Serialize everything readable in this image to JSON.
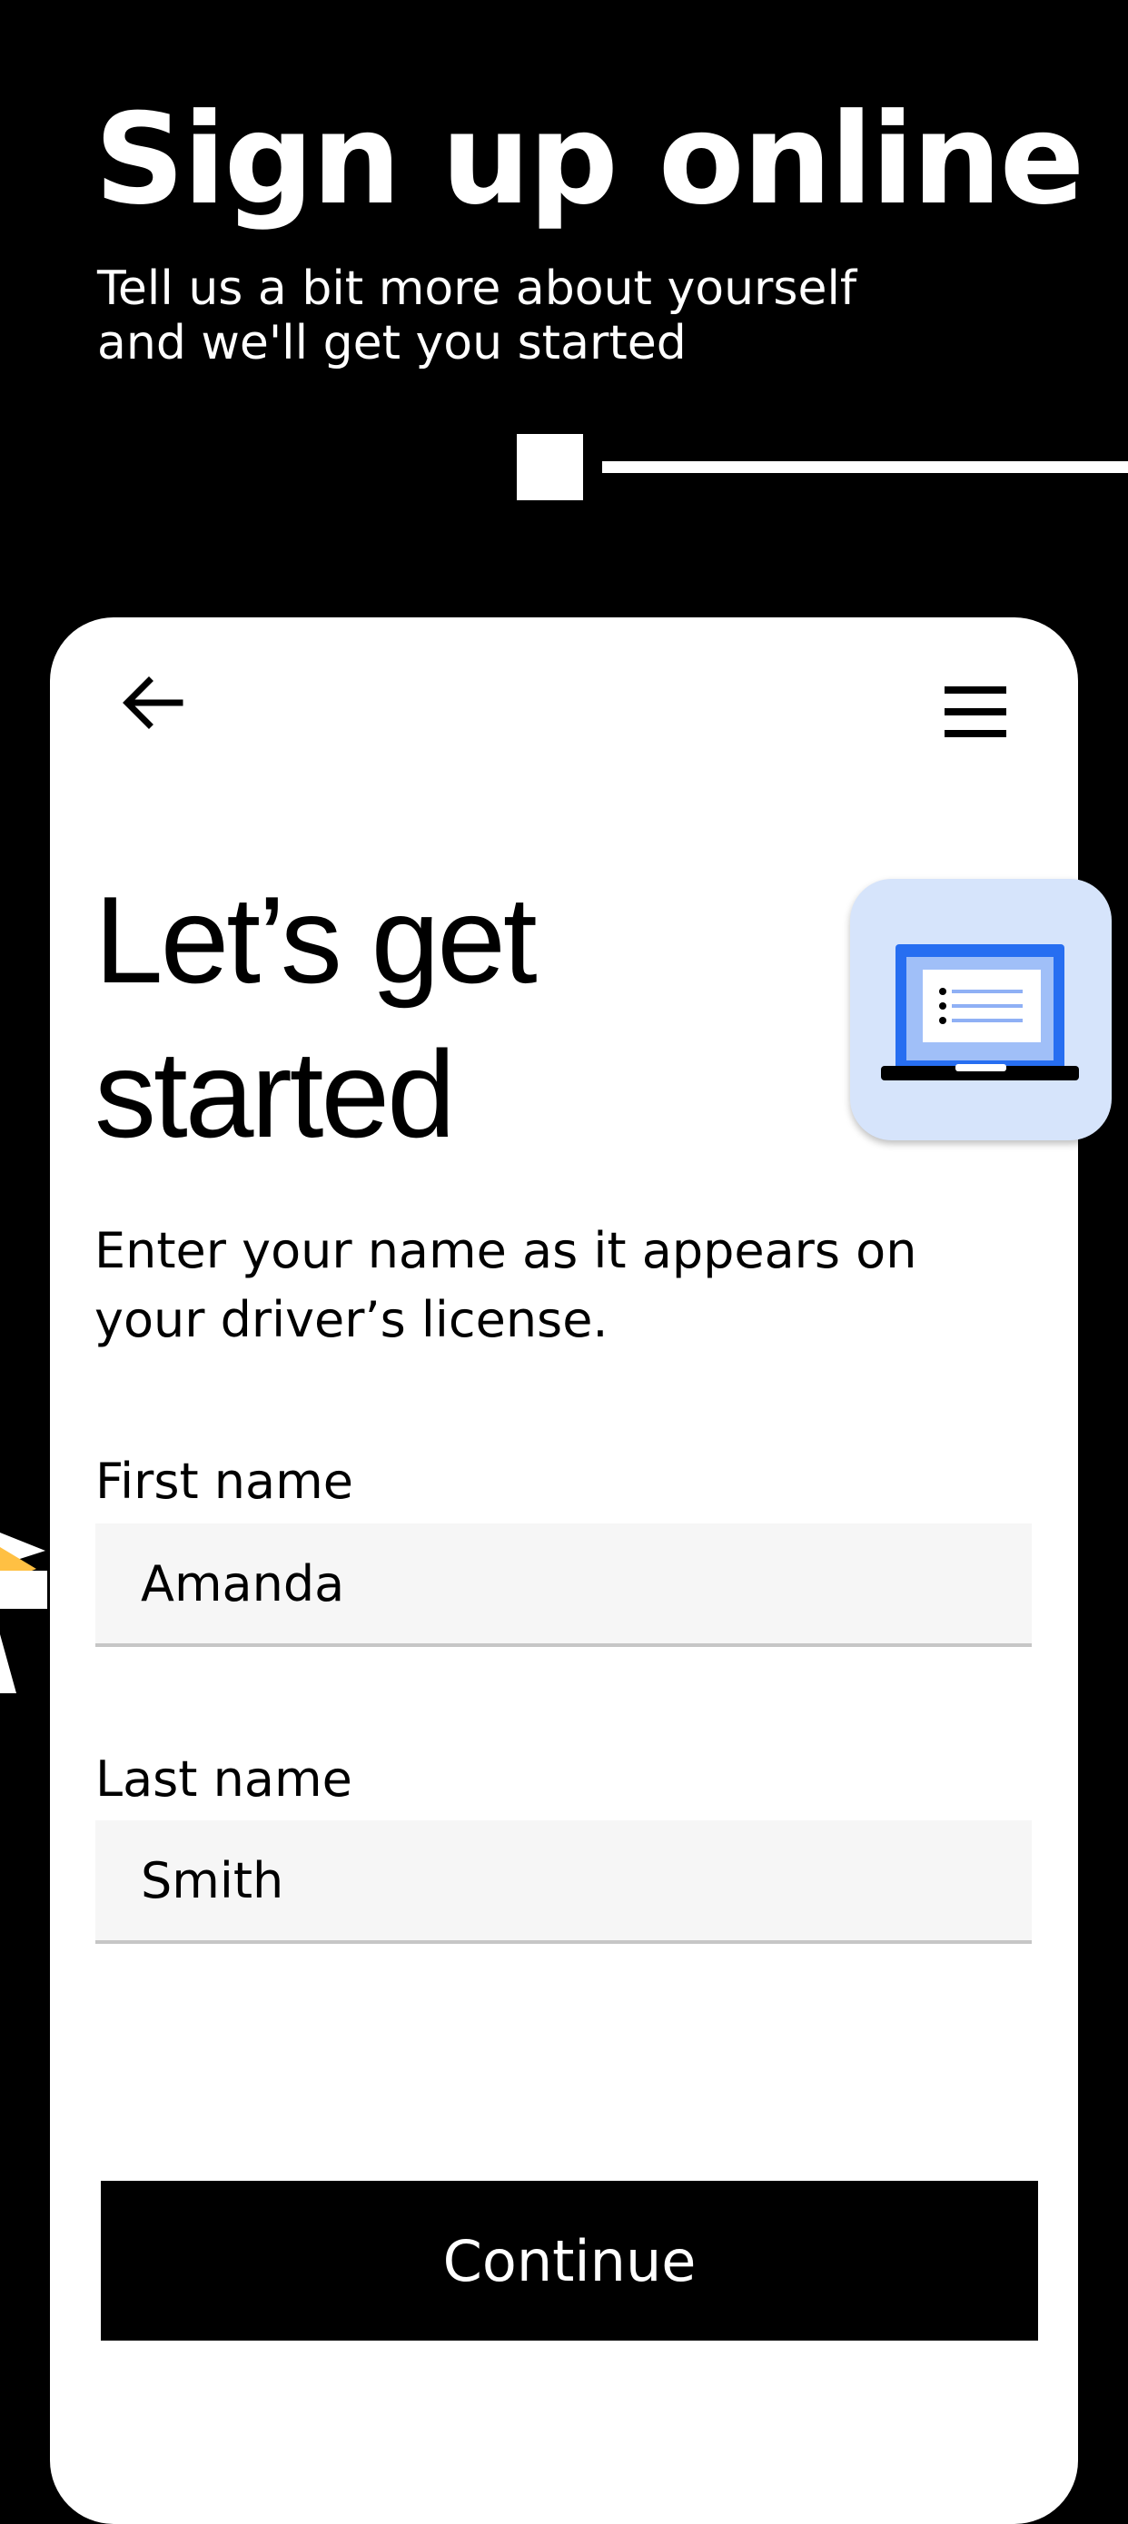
{
  "hero": {
    "title": "Sign up online",
    "subtitle": "Tell us a bit more about yourself\nand we'll get you started"
  },
  "progress": {
    "current_step": 1
  },
  "card": {
    "back_icon": "arrow-left-icon",
    "menu_icon": "hamburger-menu-icon",
    "title": "Let’s get\nstarted",
    "illustration_icon": "laptop-icon",
    "instructions": "Enter your name as it appears on\nyour driver’s license."
  },
  "form": {
    "first_name": {
      "label": "First name",
      "value": "Amanda"
    },
    "last_name": {
      "label": "Last name",
      "value": "Smith"
    }
  },
  "actions": {
    "continue_label": "Continue"
  },
  "colors": {
    "background": "#000000",
    "card": "#ffffff",
    "field_bg": "#f6f6f6",
    "illustration_bg": "#d6e4fb",
    "accent_blue": "#276ef1",
    "accent_yellow": "#ffc043"
  }
}
